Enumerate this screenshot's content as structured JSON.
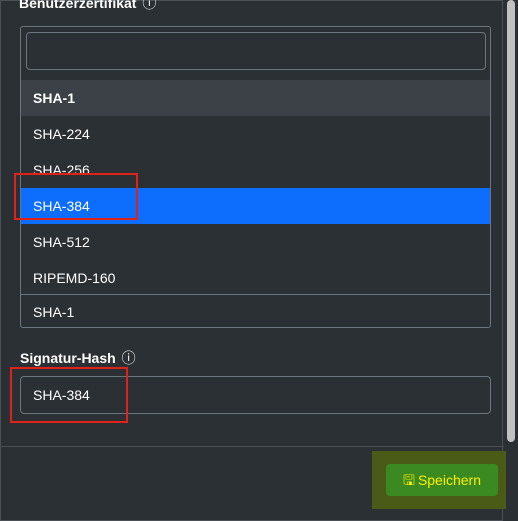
{
  "form": {
    "certificate_label": "Benutzerzertifikat",
    "help_icon": "?",
    "dropdown": {
      "search_value": "",
      "items": [
        {
          "label": "SHA-1",
          "type": "group"
        },
        {
          "label": "SHA-224",
          "type": "option"
        },
        {
          "label": "SHA-256",
          "type": "option"
        },
        {
          "label": "SHA-384",
          "type": "option",
          "highlighted": true
        },
        {
          "label": "SHA-512",
          "type": "option"
        },
        {
          "label": "RIPEMD-160",
          "type": "option"
        }
      ],
      "current_selection": "SHA-1"
    },
    "signature_hash_label": "Signatur-Hash",
    "signature_hash_value": "SHA-384"
  },
  "footer": {
    "save_label": "Speichern",
    "save_icon": "floppy-disk-icon"
  },
  "colors": {
    "background": "#2b3035",
    "highlight": "#0d6efd",
    "annotation": "#e0221b",
    "save_button": "#3b8a21",
    "save_text": "#ffee00"
  }
}
